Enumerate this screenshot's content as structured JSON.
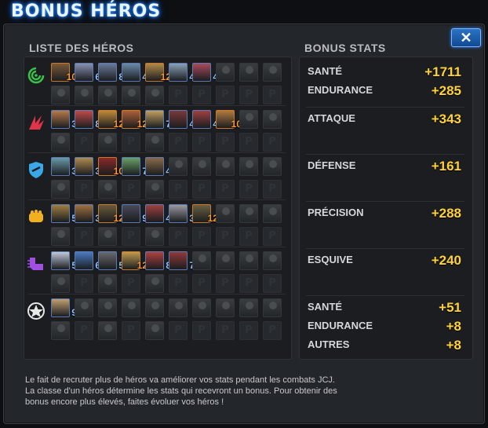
{
  "title": "BONUS HÉROS",
  "close_label": "✕",
  "left_heading": "LISTE DES HÉROS",
  "right_heading": "BONUS STATS",
  "classes": [
    {
      "name": "cosmic",
      "color": "#39c24a",
      "heroes": [
        {
          "level": "10",
          "color": "orange",
          "tint": "#7a5a3a"
        },
        {
          "level": "6",
          "color": "blue",
          "tint": "#8a8fb0"
        },
        {
          "level": "8",
          "color": "blue",
          "tint": "#6a7a9a"
        },
        {
          "level": "4",
          "color": "blue",
          "tint": "#6a8aa8"
        },
        {
          "level": "12",
          "color": "orange",
          "tint": "#b08a4a"
        },
        {
          "level": "4",
          "color": "blue",
          "tint": "#8aa0b8"
        },
        {
          "level": "4",
          "color": "blue",
          "tint": "#a84a5a"
        }
      ]
    },
    {
      "name": "mutant",
      "color": "#e0344a",
      "heroes": [
        {
          "level": "3",
          "color": "blue",
          "tint": "#b87a4a"
        },
        {
          "level": "8",
          "color": "blue",
          "tint": "#c04a4a"
        },
        {
          "level": "12",
          "color": "orange",
          "tint": "#c08a3a"
        },
        {
          "level": "12",
          "color": "orange",
          "tint": "#b0603a"
        },
        {
          "level": "7",
          "color": "blue",
          "tint": "#c0a060"
        },
        {
          "level": "4",
          "color": "blue",
          "tint": "#7a3a3a"
        },
        {
          "level": "4",
          "color": "blue",
          "tint": "#a04040"
        },
        {
          "level": "10",
          "color": "orange",
          "tint": "#b07a40"
        }
      ]
    },
    {
      "name": "scientific",
      "color": "#3aa8e8",
      "heroes": [
        {
          "level": "3",
          "color": "blue",
          "tint": "#6a9aaa"
        },
        {
          "level": "3",
          "color": "blue",
          "tint": "#b08a50"
        },
        {
          "level": "10",
          "color": "orange",
          "tint": "#8a2a2a"
        },
        {
          "level": "7",
          "color": "blue",
          "tint": "#6aa06a"
        },
        {
          "level": "4",
          "color": "blue",
          "tint": "#8a6a4a"
        }
      ]
    },
    {
      "name": "skill",
      "color": "#f0b020",
      "heroes": [
        {
          "level": "5",
          "color": "blue",
          "tint": "#a08040"
        },
        {
          "level": "3",
          "color": "blue",
          "tint": "#a07040"
        },
        {
          "level": "12",
          "color": "orange",
          "tint": "#6a5a3a"
        },
        {
          "level": "9",
          "color": "blue",
          "tint": "#4a4a5a"
        },
        {
          "level": "4",
          "color": "blue",
          "tint": "#a04040"
        },
        {
          "level": "3",
          "color": "blue",
          "tint": "#9a9aa0"
        },
        {
          "level": "12",
          "color": "orange",
          "tint": "#6a6040"
        }
      ]
    },
    {
      "name": "speed",
      "color": "#a050e0",
      "heroes": [
        {
          "level": "5",
          "color": "blue",
          "tint": "#c0c8d8"
        },
        {
          "level": "6",
          "color": "blue",
          "tint": "#4a7ac0"
        },
        {
          "level": "5",
          "color": "blue",
          "tint": "#6a6a70"
        },
        {
          "level": "12",
          "color": "orange",
          "tint": "#c09a50"
        },
        {
          "level": "8",
          "color": "blue",
          "tint": "#b04040"
        },
        {
          "level": "7",
          "color": "blue",
          "tint": "#903a3a"
        }
      ]
    },
    {
      "name": "universal",
      "color": "#e8e8e8",
      "heroes": [
        {
          "level": "9",
          "color": "blue",
          "tint": "#c0a070"
        }
      ]
    }
  ],
  "stats": [
    {
      "label": "SANTÉ",
      "value": "+1711"
    },
    {
      "label": "ENDURANCE",
      "value": "+285"
    },
    {
      "label": "ATTAQUE",
      "value": "+343"
    },
    {
      "label": "DÉFENSE",
      "value": "+161"
    },
    {
      "label": "PRÉCISION",
      "value": "+288"
    },
    {
      "label": "ESQUIVE",
      "value": "+240"
    },
    {
      "label": "SANTÉ",
      "value": "+51"
    },
    {
      "label": "ENDURANCE",
      "value": "+8"
    },
    {
      "label": "AUTRES",
      "value": "+8"
    }
  ],
  "footer": {
    "line1": "Le fait de recruter plus de héros va améliorer vos stats pendant les combats JCJ.",
    "line2": "La classe d'un héros détermine les stats qui recevront un bonus. Pour obtenir des",
    "line3": "bonus encore plus élevés, faites évoluer vos héros !"
  }
}
